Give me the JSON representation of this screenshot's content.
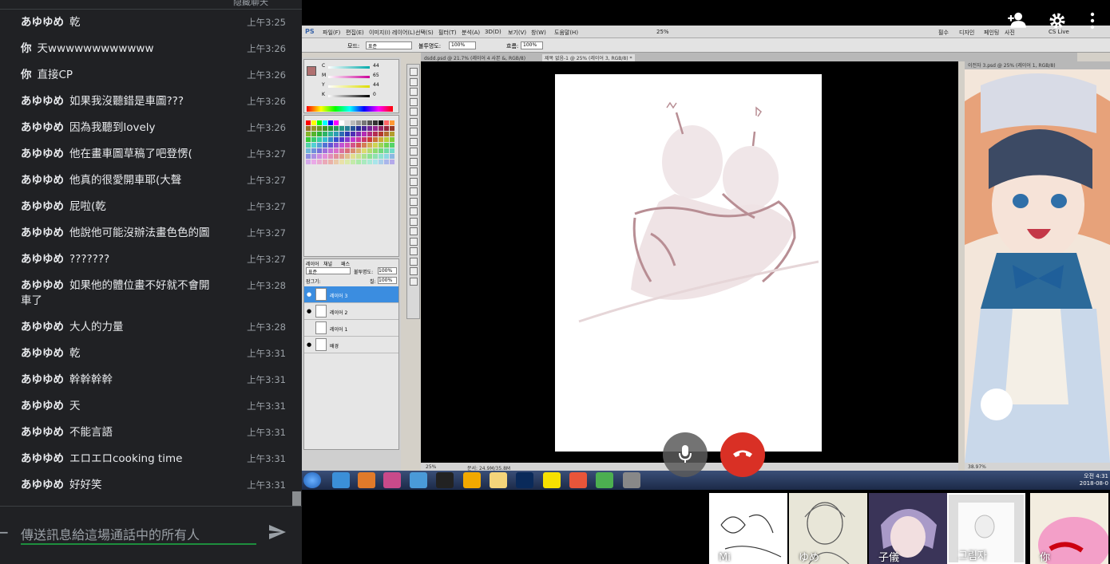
{
  "chat": {
    "header_text": "隐藏聊天",
    "messages": [
      {
        "sender": "あゆゆめ",
        "text": "乾",
        "time": "上午3:25"
      },
      {
        "sender": "你",
        "text": "天wwwwwwwwwwww",
        "time": "上午3:26"
      },
      {
        "sender": "你",
        "text": "直接CP",
        "time": "上午3:26"
      },
      {
        "sender": "あゆゆめ",
        "text": "如果我沒聽錯是車圖???",
        "time": "上午3:26"
      },
      {
        "sender": "あゆゆめ",
        "text": "因為我聽到lovely",
        "time": "上午3:26"
      },
      {
        "sender": "あゆゆめ",
        "text": "他在畫車圖草稿了吧登愣(",
        "time": "上午3:27"
      },
      {
        "sender": "あゆゆめ",
        "text": "他真的很愛開車耶(大聲",
        "time": "上午3:27"
      },
      {
        "sender": "あゆゆめ",
        "text": "屁啦(乾",
        "time": "上午3:27"
      },
      {
        "sender": "あゆゆめ",
        "text": "他說他可能沒辦法畫色色的圖",
        "time": "上午3:27"
      },
      {
        "sender": "あゆゆめ",
        "text": "???????",
        "time": "上午3:27"
      },
      {
        "sender": "あゆゆめ",
        "text": "如果他的體位畫不好就不會開車了",
        "time": "上午3:28"
      },
      {
        "sender": "あゆゆめ",
        "text": "大人的力量",
        "time": "上午3:28"
      },
      {
        "sender": "あゆゆめ",
        "text": "乾",
        "time": "上午3:31"
      },
      {
        "sender": "あゆゆめ",
        "text": "幹幹幹幹",
        "time": "上午3:31"
      },
      {
        "sender": "あゆゆめ",
        "text": "天",
        "time": "上午3:31"
      },
      {
        "sender": "あゆゆめ",
        "text": "不能言語",
        "time": "上午3:31"
      },
      {
        "sender": "あゆゆめ",
        "text": "エロエロcooking time",
        "time": "上午3:31"
      },
      {
        "sender": "あゆゆめ",
        "text": "好好笑",
        "time": "上午3:31"
      }
    ],
    "input_placeholder": "傳送訊息給這場通話中的所有人"
  },
  "photoshop": {
    "logo": "PS",
    "menu": [
      "파일(F)",
      "편집(E)",
      "이미지(I)",
      "레이어(L)",
      "선택(S)",
      "필터(T)",
      "분석(A)",
      "3D(D)",
      "보기(V)",
      "창(W)",
      "도움말(H)"
    ],
    "zoom_menu": "25%",
    "workspace": [
      "필수",
      "디자인",
      "페인팅",
      "사진"
    ],
    "cs_live": "CS Live",
    "options": {
      "mode_label": "모드:",
      "mode": "표준",
      "opacity_label": "불투명도:",
      "opacity": "100%",
      "flow_label": "흐름:",
      "flow": "100%"
    },
    "tabs": [
      "dsdd.psd @ 21.7% (레이어 4 사본 &, RGB/8)",
      "제목 없음-1 @ 25% (레이어 3, RGB/8) *"
    ],
    "ref_tab": "이전자 3.psd @ 25% (레이어 1, RGB/8)",
    "color": {
      "c": "44",
      "m": "65",
      "y": "44",
      "k": "0",
      "pct": "%"
    },
    "layers_panel": {
      "tabs": [
        "레이어",
        "채널",
        "패스"
      ],
      "blend": "표준",
      "opacity_label": "불투명도:",
      "opacity": "100%",
      "lock_label": "잠그기:",
      "fill_label": "칠:",
      "fill": "100%",
      "layers": [
        "레이어 3",
        "레이어 2",
        "레이어 1",
        "배경"
      ]
    },
    "doc_status": {
      "zoom": "25%",
      "info": "문서: 24.9M/35.8M"
    },
    "ref_status": {
      "zoom": "38.97%"
    },
    "clock": {
      "time": "오전 4:31",
      "date": "2018-08-0"
    }
  },
  "call": {
    "participants": [
      {
        "name": "Mi"
      },
      {
        "name": "ゆめ"
      },
      {
        "name": "子儀"
      },
      {
        "name": "그림자"
      },
      {
        "name": "你"
      }
    ]
  }
}
